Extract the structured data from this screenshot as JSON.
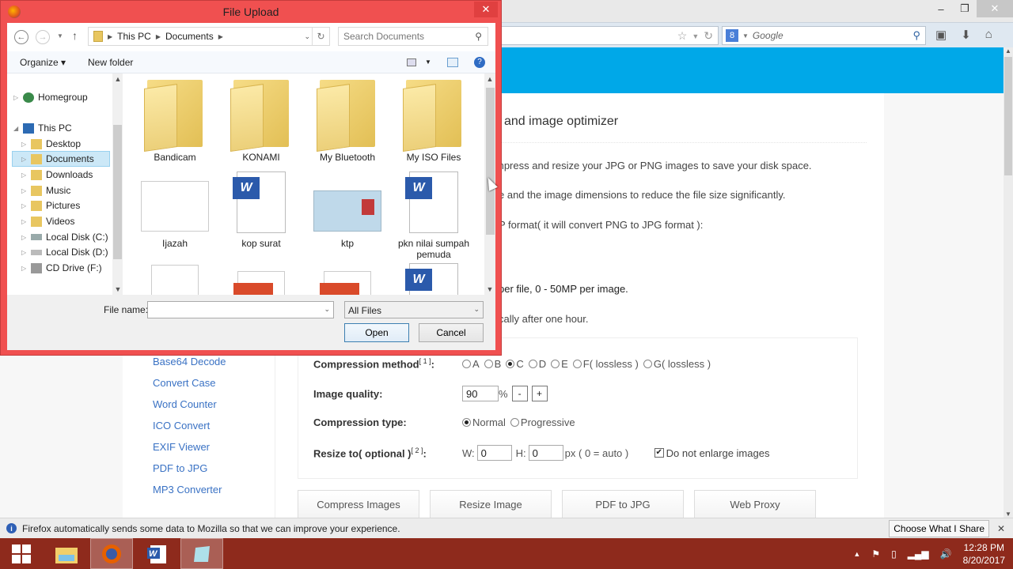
{
  "dialog": {
    "title": "File Upload",
    "close_label": "✕",
    "breadcrumb": [
      "This PC",
      "Documents"
    ],
    "search_placeholder": "Search Documents",
    "toolbar": {
      "organize": "Organize ▾",
      "new_folder": "New folder"
    },
    "nav_tree": [
      {
        "label": "Homegroup",
        "level": 0,
        "icon": "homegroup-icon"
      },
      {
        "label": "This PC",
        "level": 0,
        "icon": "computer-icon",
        "expanded": true
      },
      {
        "label": "Desktop",
        "level": 1,
        "icon": "desktop-folder-icon"
      },
      {
        "label": "Documents",
        "level": 1,
        "icon": "documents-folder-icon",
        "selected": true
      },
      {
        "label": "Downloads",
        "level": 1,
        "icon": "downloads-folder-icon"
      },
      {
        "label": "Music",
        "level": 1,
        "icon": "music-folder-icon"
      },
      {
        "label": "Pictures",
        "level": 1,
        "icon": "pictures-folder-icon"
      },
      {
        "label": "Videos",
        "level": 1,
        "icon": "videos-folder-icon"
      },
      {
        "label": "Local Disk (C:)",
        "level": 1,
        "icon": "disk-icon"
      },
      {
        "label": "Local Disk (D:)",
        "level": 1,
        "icon": "disk-icon"
      },
      {
        "label": "CD Drive (F:)",
        "level": 1,
        "icon": "cd-drive-icon"
      }
    ],
    "files": [
      {
        "name": "Bandicam",
        "type": "folder"
      },
      {
        "name": "KONAMI",
        "type": "folder"
      },
      {
        "name": "My Bluetooth",
        "type": "folder"
      },
      {
        "name": "My ISO Files",
        "type": "folder"
      },
      {
        "name": "Ijazah",
        "type": "image-scan"
      },
      {
        "name": "kop surat",
        "type": "word"
      },
      {
        "name": "ktp",
        "type": "image-id"
      },
      {
        "name": "pkn nilai sumpah pemuda",
        "type": "word"
      },
      {
        "name": "",
        "type": "image-scan"
      },
      {
        "name": "",
        "type": "pdf"
      },
      {
        "name": "",
        "type": "pdf"
      },
      {
        "name": "",
        "type": "word"
      }
    ],
    "file_name_label": "File name:",
    "file_name_value": "",
    "file_type": "All Files",
    "open_label": "Open",
    "cancel_label": "Cancel"
  },
  "browser": {
    "search_engine": "Google",
    "notification": "Firefox automatically sends some data to Mozilla so that we can improve your experience.",
    "notification_button": "Choose What I Share"
  },
  "page": {
    "title_partial": "and image optimizer",
    "desc_lines": [
      "mpress and resize your JPG or PNG images to save your disk space.",
      "e and the image dimensions to reduce the file size significantly.",
      "P format( it will convert PNG to JPG format ):",
      "per file, 0 - 50MP per image.",
      "cally after one hour."
    ],
    "sidebar_links": [
      "Base64 Decode",
      "Convert Case",
      "Word Counter",
      "ICO Convert",
      "EXIF Viewer",
      "PDF to JPG",
      "MP3 Converter"
    ],
    "options": {
      "compression_method_label": "Compression method",
      "compression_method_ref": "[ 1 ]",
      "compression_methods": [
        "A",
        "B",
        "C",
        "D",
        "E",
        "F( lossless )",
        "G( lossless )"
      ],
      "compression_method_selected": "C",
      "image_quality_label": "Image quality:",
      "image_quality_value": "90",
      "percent": "%",
      "minus": "-",
      "plus": "+",
      "compression_type_label": "Compression type:",
      "compression_types": [
        "Normal",
        "Progressive"
      ],
      "compression_type_selected": "Normal",
      "resize_label": "Resize to( optional )",
      "resize_ref": "[ 2 ]",
      "w_label": "W:",
      "w_value": "0",
      "h_label": "H:",
      "h_value": "0",
      "px_note": "px ( 0 = auto )",
      "no_enlarge_label": "Do not enlarge images",
      "no_enlarge_checked": true
    },
    "action_buttons": [
      "Compress Images",
      "Resize Image",
      "PDF to JPG",
      "Web Proxy"
    ]
  },
  "taskbar": {
    "apps": [
      "start-button",
      "file-explorer",
      "firefox",
      "word",
      "notepad"
    ],
    "time": "12:28 PM",
    "date": "8/20/2017"
  }
}
